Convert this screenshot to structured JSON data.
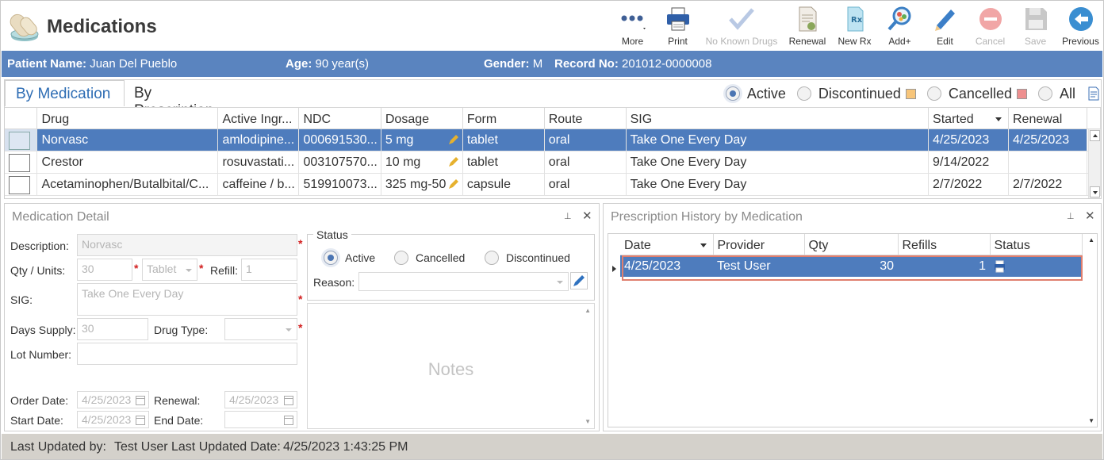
{
  "app": {
    "title": "Medications"
  },
  "toolbar": {
    "more": "More",
    "print": "Print",
    "no_known_drugs": "No Known Drugs",
    "renewal": "Renewal",
    "new_rx": "New Rx",
    "add_plus": "Add+",
    "edit": "Edit",
    "cancel": "Cancel",
    "save": "Save",
    "previous": "Previous"
  },
  "patient": {
    "name_label": "Patient Name:",
    "name": "Juan Del Pueblo",
    "age_label": "Age:",
    "age": "90 year(s)",
    "gender_label": "Gender:",
    "gender": "M",
    "record_label": "Record No:",
    "record": "201012-0000008"
  },
  "tabs": {
    "by_medication": "By Medication",
    "by_prescription": "By Prescription"
  },
  "filters": {
    "active": "Active",
    "discontinued": "Discontinued",
    "cancelled": "Cancelled",
    "all": "All",
    "selected": "Active"
  },
  "colors": {
    "accent": "#5a84bf",
    "selected_row": "#4e7cbd",
    "discontinued_swatch": "#f7c57a",
    "cancelled_swatch": "#ee8f8f",
    "required": "#d21f1f",
    "highlight_border": "#e07f6e"
  },
  "med_grid": {
    "columns": [
      "Drug",
      "Active Ingr...",
      "NDC",
      "Dosage",
      "Form",
      "Route",
      "SIG",
      "Started",
      "Renewal"
    ],
    "rows": [
      {
        "drug": "Norvasc",
        "ingredient": "amlodipine...",
        "ndc": "000691530...",
        "dosage": "5 mg",
        "form": "tablet",
        "route": "oral",
        "sig": "Take One Every Day",
        "started": "4/25/2023",
        "renewal": "4/25/2023"
      },
      {
        "drug": "Crestor",
        "ingredient": "rosuvastati...",
        "ndc": "003107570...",
        "dosage": "10 mg",
        "form": "tablet",
        "route": "oral",
        "sig": "Take One Every Day",
        "started": "9/14/2022",
        "renewal": ""
      },
      {
        "drug": "Acetaminophen/Butalbital/C...",
        "ingredient": "caffeine / b...",
        "ndc": "519910073...",
        "dosage": "325 mg-50",
        "form": "capsule",
        "route": "oral",
        "sig": "Take One Every Day",
        "started": "2/7/2022",
        "renewal": "2/7/2022"
      }
    ]
  },
  "detail": {
    "title": "Medication Detail",
    "description_label": "Description:",
    "description": "Norvasc",
    "qty_label": "Qty / Units:",
    "qty": "30",
    "units": "Tablet",
    "refill_label": "Refill:",
    "refill": "1",
    "sig_label": "SIG:",
    "sig": "Take One Every Day",
    "days_supply_label": "Days Supply:",
    "days_supply": "30",
    "drug_type_label": "Drug Type:",
    "drug_type": "",
    "lot_label": "Lot Number:",
    "lot": "",
    "order_date_label": "Order Date:",
    "order_date": "4/25/2023",
    "renewal_label": "Renewal:",
    "renewal": "4/25/2023",
    "start_date_label": "Start Date:",
    "start_date": "4/25/2023",
    "end_date_label": "End Date:",
    "end_date": "",
    "status_legend": "Status",
    "status_active": "Active",
    "status_cancelled": "Cancelled",
    "status_discontinued": "Discontinued",
    "reason_label": "Reason:",
    "notes_placeholder": "Notes"
  },
  "history": {
    "title": "Prescription History by Medication",
    "columns": [
      "Date",
      "Provider",
      "Qty",
      "Refills",
      "Status"
    ],
    "rows": [
      {
        "date": "4/25/2023",
        "provider": "Test User",
        "qty": "30",
        "refills": "1"
      }
    ]
  },
  "footer": {
    "updated_by_label": "Last Updated by:",
    "updated_by": "Test User",
    "updated_date_label": "Last Updated Date:",
    "updated_date": "4/25/2023 1:43:25 PM"
  }
}
